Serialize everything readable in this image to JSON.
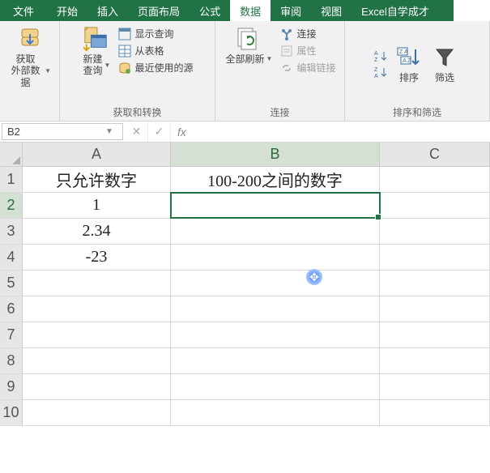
{
  "tabs": {
    "file": "文件",
    "home": "开始",
    "insert": "插入",
    "layout": "页面布局",
    "formulas": "公式",
    "data": "数据",
    "review": "审阅",
    "view": "视图",
    "addin": "Excel自学成才"
  },
  "activeTab": "数据",
  "ribbon": {
    "get_external": {
      "label": "获取\n外部数据",
      "group_label": ""
    },
    "new_query": {
      "label": "新建\n查询",
      "show_query": "显示查询",
      "from_table": "从表格",
      "recent_sources": "最近使用的源",
      "group_label": "获取和转换"
    },
    "refresh_all": {
      "label": "全部刷新",
      "connections": "连接",
      "properties": "属性",
      "edit_links": "编辑链接",
      "group_label": "连接"
    },
    "sort": {
      "label": "排序",
      "group_label": "排序和筛选"
    },
    "filter": {
      "label": "筛选"
    }
  },
  "formula_bar": {
    "name_box": "B2",
    "fx_label": "fx",
    "formula": ""
  },
  "sheet": {
    "columns": [
      "A",
      "B",
      "C"
    ],
    "row_count": 10,
    "selected_cell": "B2",
    "cells": {
      "A1": "只允许数字",
      "B1": "100-200之间的数字",
      "A2": "1",
      "A3": "2.34",
      "A4": "-23"
    }
  },
  "chart_data": {
    "type": "table",
    "columns": [
      "只允许数字",
      "100-200之间的数字"
    ],
    "rows": [
      [
        1,
        null
      ],
      [
        2.34,
        null
      ],
      [
        -23,
        null
      ]
    ]
  }
}
